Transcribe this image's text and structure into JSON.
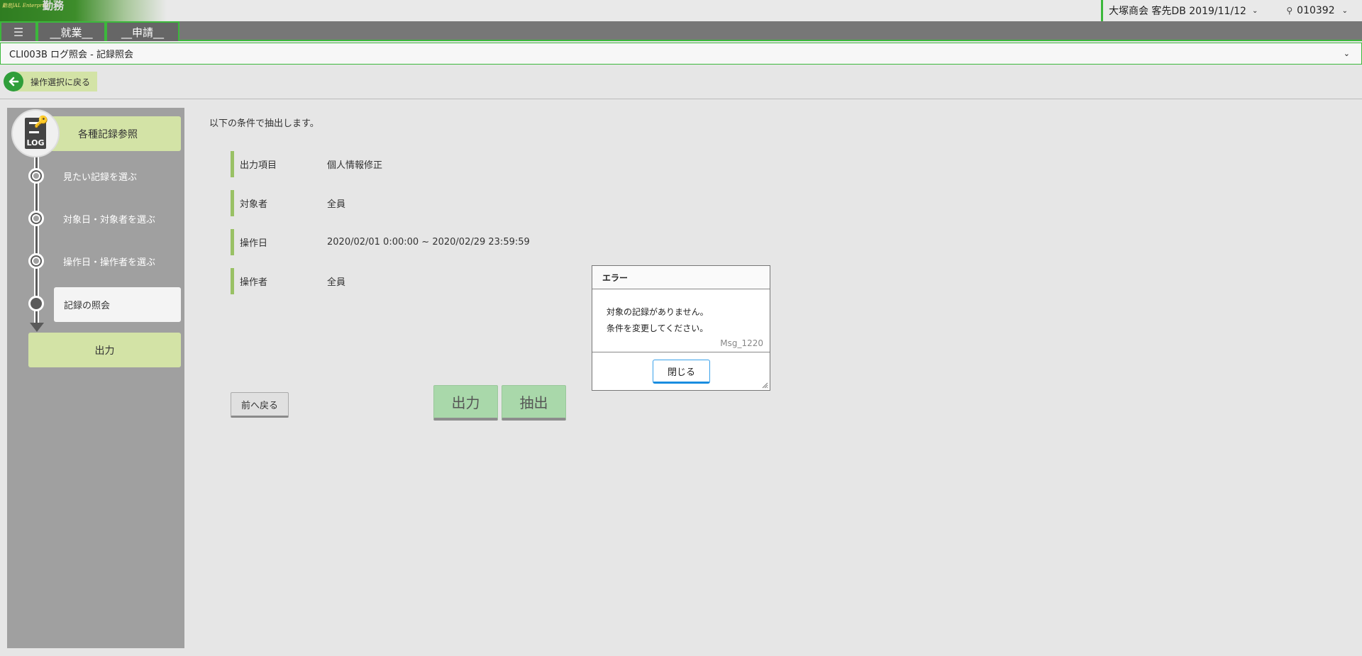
{
  "header": {
    "logo_text": "勤怠JAL Enterprise",
    "logo_mark": "勤務",
    "company": "大塚商会 客先DB 2019/11/12",
    "user_id": "010392"
  },
  "menu": {
    "hamburger": "☰",
    "items": [
      "__就業__",
      "__申請__"
    ]
  },
  "page": {
    "title": "CLI003B ログ照会 - 記録照会",
    "back_label": "操作選択に戻る"
  },
  "sidebar": {
    "log_icon_text": "LOG",
    "head_label": "各種記録参照",
    "steps": [
      "見たい記録を選ぶ",
      "対象日・対象者を選ぶ",
      "操作日・操作者を選ぶ",
      "記録の照会"
    ],
    "output_label": "出力"
  },
  "main": {
    "intro": "以下の条件で抽出します。",
    "conditions": [
      {
        "key": "出力項目",
        "value": "個人情報修正"
      },
      {
        "key": "対象者",
        "value": "全員"
      },
      {
        "key": "操作日",
        "value": "2020/02/01 0:00:00 ~ 2020/02/29 23:59:59"
      },
      {
        "key": "操作者",
        "value": "全員"
      }
    ],
    "prev_button": "前へ戻る",
    "output_button": "出力",
    "extract_button": "抽出"
  },
  "dialog": {
    "title": "エラー",
    "line1": "対象の記録がありません。",
    "line2": "条件を変更してください。",
    "code": "Msg_1220",
    "close_button": "閉じる"
  }
}
